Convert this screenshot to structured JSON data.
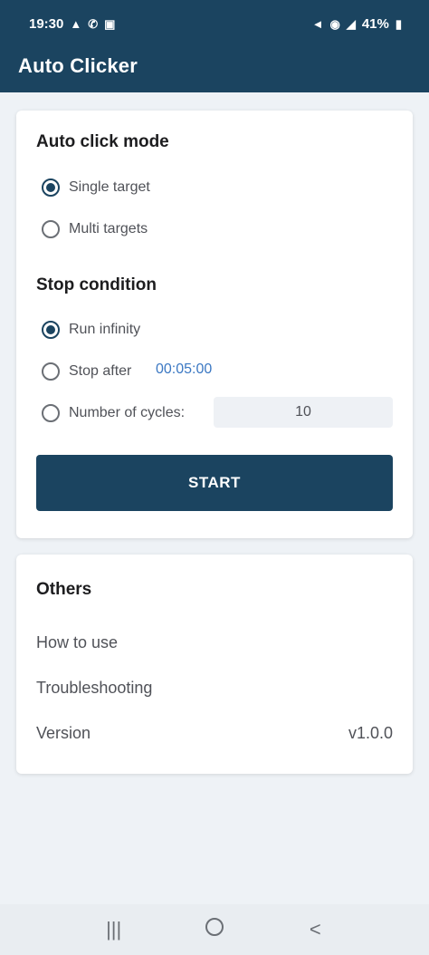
{
  "status_bar": {
    "time": "19:30",
    "left_icons": [
      "warning-icon",
      "phone-icon",
      "notification-icon"
    ],
    "right_icons": [
      "mute-icon",
      "wifi-icon",
      "signal-icon"
    ],
    "battery": "41%"
  },
  "app_bar": {
    "title": "Auto Clicker"
  },
  "auto_click_mode": {
    "title": "Auto click mode",
    "options": [
      {
        "label": "Single target",
        "selected": true
      },
      {
        "label": "Multi targets",
        "selected": false
      }
    ]
  },
  "stop_condition": {
    "title": "Stop condition",
    "options": [
      {
        "label": "Run infinity",
        "selected": true
      },
      {
        "label": "Stop after",
        "selected": false,
        "value": "00:05:00"
      },
      {
        "label": "Number of cycles:",
        "selected": false,
        "value": "10"
      }
    ]
  },
  "start_button": {
    "label": "START"
  },
  "others": {
    "title": "Others",
    "items": [
      {
        "label": "How to use"
      },
      {
        "label": "Troubleshooting"
      },
      {
        "label": "Version",
        "value": "v1.0.0"
      }
    ]
  },
  "nav_bar": {
    "icons": [
      "recents-icon",
      "home-icon",
      "back-icon"
    ]
  },
  "colors": {
    "primary": "#1b4460",
    "link": "#3b78c3",
    "background": "#eef2f6"
  }
}
